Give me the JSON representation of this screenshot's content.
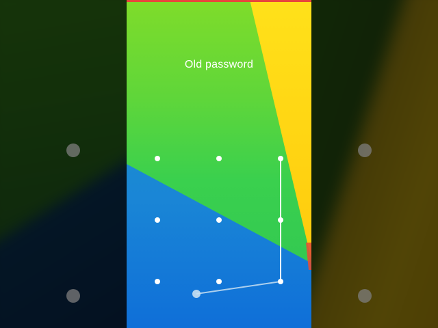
{
  "lockscreen": {
    "prompt": "Old password"
  },
  "pattern": {
    "grid_size": 3,
    "selected_sequence": [
      2,
      5,
      8
    ],
    "dragging_toward": "bottom-left"
  },
  "colors": {
    "accent_bar": "#e8463c",
    "dot": "#ffffff",
    "line": "#ffffff",
    "touch_indicator": "#c9e0f2"
  },
  "icons": {
    "dot": "pattern-dot-icon",
    "touch": "touch-point-icon"
  }
}
